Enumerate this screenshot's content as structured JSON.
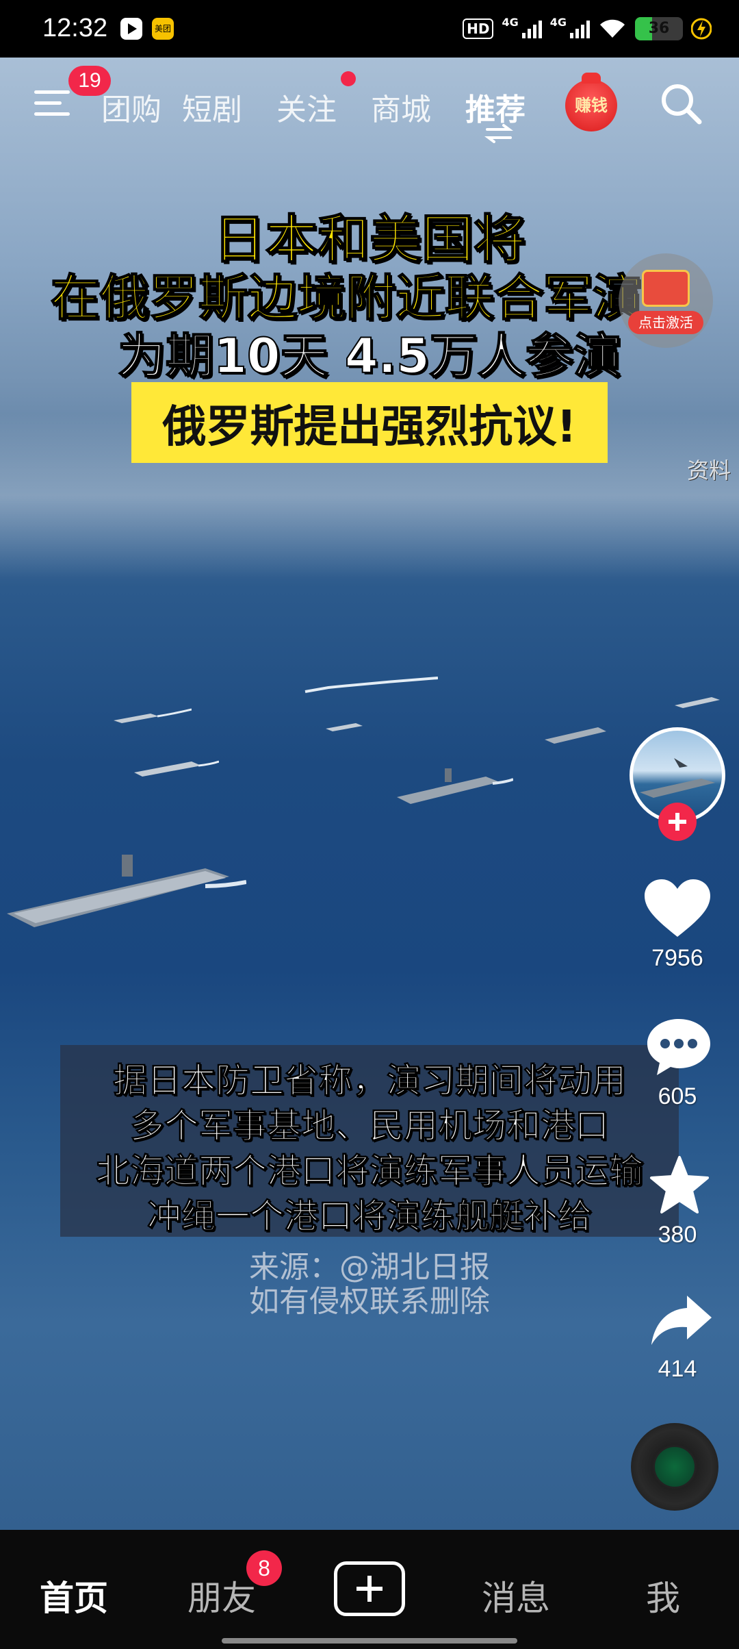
{
  "status_bar": {
    "time": "12:32",
    "app_icon_2": "美团",
    "hd": "HD",
    "signal_1": "4G",
    "signal_2": "4G",
    "battery": "36"
  },
  "top_nav": {
    "menu_badge": "19",
    "tabs": [
      {
        "label": "团购"
      },
      {
        "label": "短剧"
      },
      {
        "label": "关注"
      },
      {
        "label": "商城"
      },
      {
        "label": "推荐"
      }
    ],
    "earn_label": "赚钱"
  },
  "video": {
    "headline": {
      "line1": "日本和美国将",
      "line2": "在俄罗斯边境附近联合军演",
      "line3": "为期10天 4.5万人参演",
      "banner": "俄罗斯提出强烈抗议!"
    },
    "ad_label": "点击激活",
    "side_text": "资料",
    "subtitles": [
      "据日本防卫省称，演习期间将动用",
      "多个军事基地、民用机场和港口",
      "北海道两个港口将演练军事人员运输",
      "冲绳一个港口将演练舰艇补给"
    ],
    "source_line1": "来源：@湖北日报",
    "source_line2": "如有侵权联系删除"
  },
  "right_rail": {
    "likes": "7956",
    "comments": "605",
    "favorites": "380",
    "shares": "414"
  },
  "bottom_nav": {
    "home": "首页",
    "friends": "朋友",
    "friends_badge": "8",
    "messages": "消息",
    "me": "我"
  },
  "colors": {
    "accent_red": "#f2274a",
    "headline_yellow": "#ffe600",
    "banner_yellow": "#ffe838"
  }
}
